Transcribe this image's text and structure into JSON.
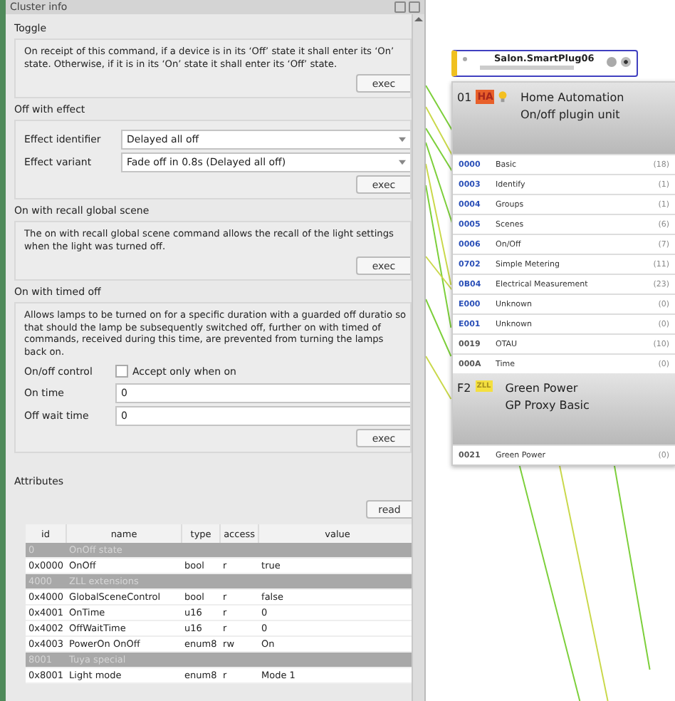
{
  "panel": {
    "title": "Cluster info",
    "commands": [
      {
        "kind": "text",
        "title": "Toggle",
        "description": "On receipt of this command, if a device is in its ‘Off’ state it shall enter its ‘On’ state. Otherwise, if it is in its ‘On’ state it shall enter its ‘Off’ state.",
        "button": "exec"
      },
      {
        "kind": "form",
        "title": "Off with effect",
        "fields": [
          {
            "kind": "select",
            "label": "Effect identifier",
            "value": "Delayed all off"
          },
          {
            "kind": "select",
            "label": "Effect variant",
            "value": "Fade off in 0.8s (Delayed all off)"
          }
        ],
        "button": "exec"
      },
      {
        "kind": "text",
        "title": "On with recall global scene",
        "description": "The on with recall global scene command allows the recall of the light settings when the light was turned off.",
        "button": "exec"
      },
      {
        "kind": "form",
        "title": "On with timed off",
        "description": "Allows lamps to be turned on for a specific duration with a guarded off duratio so that should the lamp be subsequently switched off, further on with timed of commands, received during this time, are prevented from turning the lamps back on.",
        "fields": [
          {
            "kind": "checkbox",
            "label": "On/off control",
            "option": "Accept only when on",
            "checked": false
          },
          {
            "kind": "input",
            "label": "On time",
            "value": "0"
          },
          {
            "kind": "input",
            "label": "Off wait time",
            "value": "0"
          }
        ],
        "button": "exec"
      }
    ],
    "attributes": {
      "title": "Attributes",
      "button": "read",
      "columns": [
        "id",
        "name",
        "type",
        "access",
        "value"
      ],
      "rows": [
        {
          "kind": "group",
          "cells": [
            "0",
            "OnOff state"
          ]
        },
        {
          "kind": "attribute",
          "cells": [
            "0x0000",
            "OnOff",
            "bool",
            "r",
            "true"
          ]
        },
        {
          "kind": "group",
          "cells": [
            "4000",
            "ZLL extensions"
          ]
        },
        {
          "kind": "attribute",
          "cells": [
            "0x4000",
            "GlobalSceneControl",
            "bool",
            "r",
            "false"
          ]
        },
        {
          "kind": "attribute",
          "cells": [
            "0x4001",
            "OnTime",
            "u16",
            "r",
            "0"
          ]
        },
        {
          "kind": "attribute",
          "cells": [
            "0x4002",
            "OffWaitTime",
            "u16",
            "r",
            "0"
          ]
        },
        {
          "kind": "attribute",
          "cells": [
            "0x4003",
            "PowerOn OnOff",
            "enum8",
            "rw",
            "On"
          ]
        },
        {
          "kind": "group",
          "cells": [
            "8001",
            "Tuya special"
          ]
        },
        {
          "kind": "attribute",
          "cells": [
            "0x8001",
            "Light mode",
            "enum8",
            "r",
            "Mode 1"
          ]
        }
      ]
    }
  },
  "node": {
    "name": "Salon.SmartPlug06",
    "endpoints": [
      {
        "number": "01",
        "badge": "HA",
        "kind": "ha",
        "title": "Home Automation",
        "subtitle": "On/off plugin unit",
        "clusters": [
          {
            "id": "0000",
            "name": "Basic",
            "count": "(18)",
            "color": "#2b50b8"
          },
          {
            "id": "0003",
            "name": "Identify",
            "count": "(1)",
            "color": "#2b50b8"
          },
          {
            "id": "0004",
            "name": "Groups",
            "count": "(1)",
            "color": "#2b50b8"
          },
          {
            "id": "0005",
            "name": "Scenes",
            "count": "(6)",
            "color": "#2b50b8"
          },
          {
            "id": "0006",
            "name": "On/Off",
            "count": "(7)",
            "color": "#2b50b8"
          },
          {
            "id": "0702",
            "name": "Simple Metering",
            "count": "(11)",
            "color": "#2b50b8"
          },
          {
            "id": "0B04",
            "name": "Electrical Measurement",
            "count": "(23)",
            "color": "#2b50b8"
          },
          {
            "id": "E000",
            "name": "Unknown",
            "count": "(0)",
            "color": "#2b50b8"
          },
          {
            "id": "E001",
            "name": "Unknown",
            "count": "(0)",
            "color": "#2b50b8"
          },
          {
            "id": "0019",
            "name": "OTAU",
            "count": "(10)",
            "color": "#555555"
          },
          {
            "id": "000A",
            "name": "Time",
            "count": "(0)",
            "color": "#555555"
          }
        ]
      },
      {
        "number": "F2",
        "badge": "ZLL",
        "kind": "zll",
        "title": "Green Power",
        "subtitle": "GP Proxy Basic",
        "clusters": [
          {
            "id": "0021",
            "name": "Green Power",
            "count": "(0)",
            "color": "#555555"
          }
        ]
      }
    ]
  }
}
